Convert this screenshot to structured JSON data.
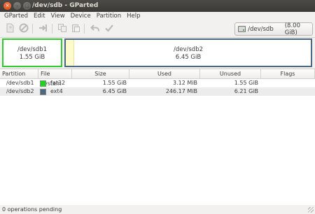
{
  "window": {
    "title": "/dev/sdb - GParted",
    "buttons": {
      "close": "×",
      "minimize": "–",
      "maximize": "□"
    }
  },
  "menubar": {
    "items": [
      "GParted",
      "Edit",
      "View",
      "Device",
      "Partition",
      "Help"
    ]
  },
  "toolbar": {
    "buttons": [
      "new-icon",
      "delete-icon",
      "resize-move-icon",
      "copy-icon",
      "paste-icon",
      "undo-icon",
      "apply-icon"
    ],
    "device_selector": {
      "name": "/dev/sdb",
      "size": "(8.00 GiB)",
      "icon": "hard-disk-icon"
    }
  },
  "graph": {
    "partitions": [
      {
        "name": "/dev/sdb1",
        "size": "1.55 GiB",
        "border_color": "#2ecc2e"
      },
      {
        "name": "/dev/sdb2",
        "size": "6.45 GiB",
        "border_color": "#4b6883"
      }
    ]
  },
  "table": {
    "headers": {
      "partition": "Partition",
      "filesystem": "File System",
      "size": "Size",
      "used": "Used",
      "unused": "Unused",
      "flags": "Flags"
    },
    "rows": [
      {
        "partition": "/dev/sdb1",
        "filesystem": "fat32",
        "fs_color": "#18d818",
        "size": "1.55 GiB",
        "used": "3.12 MiB",
        "unused": "1.55 GiB",
        "flags": ""
      },
      {
        "partition": "/dev/sdb2",
        "filesystem": "ext4",
        "fs_color": "#4b6883",
        "size": "6.45 GiB",
        "used": "246.17 MiB",
        "unused": "6.21 GiB",
        "flags": ""
      }
    ]
  },
  "statusbar": {
    "text": "0 operations pending"
  }
}
